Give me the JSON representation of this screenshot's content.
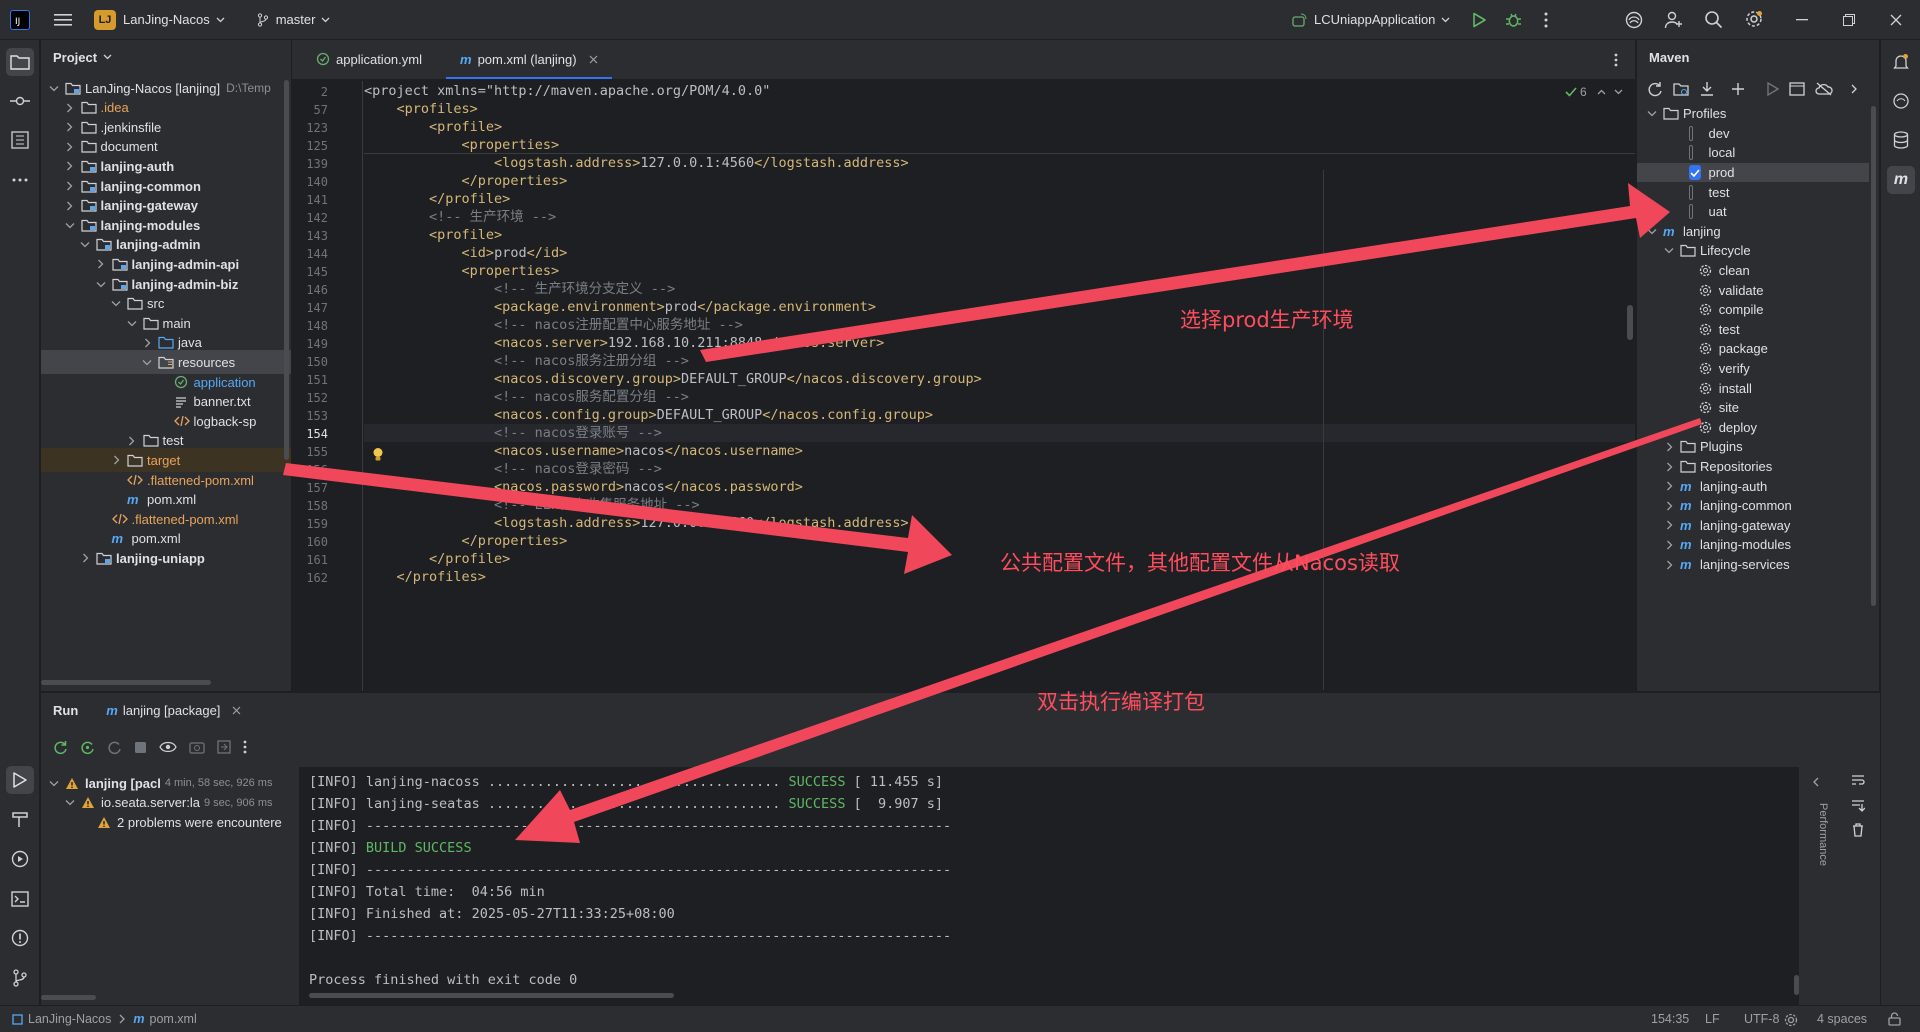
{
  "titlebar": {
    "project_badge": "LJ",
    "project_name": "LanJing-Nacos",
    "branch": "master",
    "run_config": "LCUniappApplication"
  },
  "project_panel": {
    "title": "Project",
    "items": [
      {
        "label": "LanJing-Nacos [lanjing]",
        "hint": "D:\\Temp",
        "depth": 0,
        "expanded": true,
        "kind": "module",
        "bold": false
      },
      {
        "label": ".idea",
        "depth": 1,
        "expanded": false,
        "kind": "folder",
        "color": "orange"
      },
      {
        "label": ".jenkinsfile",
        "depth": 1,
        "expanded": false,
        "kind": "folder"
      },
      {
        "label": "document",
        "depth": 1,
        "expanded": false,
        "kind": "folder"
      },
      {
        "label": "lanjing-auth",
        "depth": 1,
        "expanded": false,
        "kind": "module",
        "bold": true
      },
      {
        "label": "lanjing-common",
        "depth": 1,
        "expanded": false,
        "kind": "module",
        "bold": true
      },
      {
        "label": "lanjing-gateway",
        "depth": 1,
        "expanded": false,
        "kind": "module",
        "bold": true
      },
      {
        "label": "lanjing-modules",
        "depth": 1,
        "expanded": true,
        "kind": "module",
        "bold": true
      },
      {
        "label": "lanjing-admin",
        "depth": 2,
        "expanded": true,
        "kind": "module",
        "bold": true
      },
      {
        "label": "lanjing-admin-api",
        "depth": 3,
        "expanded": false,
        "kind": "module",
        "bold": true
      },
      {
        "label": "lanjing-admin-biz",
        "depth": 3,
        "expanded": true,
        "kind": "module",
        "bold": true
      },
      {
        "label": "src",
        "depth": 4,
        "expanded": true,
        "kind": "folder"
      },
      {
        "label": "main",
        "depth": 5,
        "expanded": true,
        "kind": "folder"
      },
      {
        "label": "java",
        "depth": 6,
        "expanded": false,
        "kind": "folder-blue"
      },
      {
        "label": "resources",
        "depth": 6,
        "expanded": true,
        "kind": "folder-res",
        "selected": true
      },
      {
        "label": "application",
        "depth": 7,
        "kind": "yml",
        "color": "blue"
      },
      {
        "label": "banner.txt",
        "depth": 7,
        "kind": "txt"
      },
      {
        "label": "logback-sp",
        "depth": 7,
        "kind": "xml"
      },
      {
        "label": "test",
        "depth": 5,
        "expanded": false,
        "kind": "folder"
      },
      {
        "label": "target",
        "depth": 4,
        "expanded": false,
        "kind": "folder",
        "color": "orange",
        "highlight": true
      },
      {
        "label": ".flattened-pom.xml",
        "depth": 4,
        "kind": "xml",
        "color": "orange"
      },
      {
        "label": "pom.xml",
        "depth": 4,
        "kind": "maven"
      },
      {
        "label": ".flattened-pom.xml",
        "depth": 3,
        "kind": "xml",
        "color": "orange"
      },
      {
        "label": "pom.xml",
        "depth": 3,
        "kind": "maven"
      },
      {
        "label": "lanjing-uniapp",
        "depth": 2,
        "expanded": false,
        "kind": "module",
        "bold": true
      }
    ]
  },
  "editor": {
    "tabs": [
      {
        "label": "application.yml",
        "active": false
      },
      {
        "label": "pom.xml (lanjing)",
        "active": true
      }
    ],
    "inspections": "6",
    "lines": [
      {
        "n": "2",
        "code": "<project xmlns=\"http://maven.apache.org/POM/4.0.0\"",
        "type": "sticky"
      },
      {
        "n": "57",
        "code": "    <profiles>",
        "type": "sticky"
      },
      {
        "n": "123",
        "code": "        <profile>",
        "type": "sticky"
      },
      {
        "n": "125",
        "code": "            <properties>",
        "type": "sticky"
      },
      {
        "n": "139",
        "code": "                <logstash.address>127.0.0.1:4560</logstash.address>",
        "type": "tag"
      },
      {
        "n": "140",
        "code": "            </properties>",
        "type": "tag"
      },
      {
        "n": "141",
        "code": "        </profile>",
        "type": "tag"
      },
      {
        "n": "142",
        "code": "        <!-- 生产环境 -->",
        "type": "comment"
      },
      {
        "n": "143",
        "code": "        <profile>",
        "type": "tag"
      },
      {
        "n": "144",
        "code": "            <id>prod</id>",
        "type": "tag"
      },
      {
        "n": "145",
        "code": "            <properties>",
        "type": "tag"
      },
      {
        "n": "146",
        "code": "                <!-- 生产环境分支定义 -->",
        "type": "comment"
      },
      {
        "n": "147",
        "code": "                <package.environment>prod</package.environment>",
        "type": "tag"
      },
      {
        "n": "148",
        "code": "                <!-- nacos注册配置中心服务地址 -->",
        "type": "comment"
      },
      {
        "n": "149",
        "code": "                <nacos.server>192.168.10.211:8848</nacos.server>",
        "type": "tag"
      },
      {
        "n": "150",
        "code": "                <!-- nacos服务注册分组 -->",
        "type": "comment"
      },
      {
        "n": "151",
        "code": "                <nacos.discovery.group>DEFAULT_GROUP</nacos.discovery.group>",
        "type": "tag"
      },
      {
        "n": "152",
        "code": "                <!-- nacos服务配置分组 -->",
        "type": "comment"
      },
      {
        "n": "153",
        "code": "                <nacos.config.group>DEFAULT_GROUP</nacos.config.group>",
        "type": "tag"
      },
      {
        "n": "154",
        "code": "                <!-- nacos登录账号 -->",
        "type": "comment",
        "current": true
      },
      {
        "n": "155",
        "code": "                <nacos.username>nacos</nacos.username>",
        "type": "tag"
      },
      {
        "n": "156",
        "code": "                <!-- nacos登录密码 -->",
        "type": "comment"
      },
      {
        "n": "157",
        "code": "                <nacos.password>nacos</nacos.password>",
        "type": "tag"
      },
      {
        "n": "158",
        "code": "                <!-- ELK日志收集服务地址 -->",
        "type": "comment"
      },
      {
        "n": "159",
        "code": "                <logstash.address>127.0.0.1:4560</logstash.address>",
        "type": "tag"
      },
      {
        "n": "160",
        "code": "            </properties>",
        "type": "tag"
      },
      {
        "n": "161",
        "code": "        </profile>",
        "type": "tag"
      },
      {
        "n": "162",
        "code": "    </profiles>",
        "type": "tag"
      }
    ]
  },
  "maven": {
    "title": "Maven",
    "profiles_label": "Profiles",
    "profiles": [
      {
        "name": "dev",
        "checked": false
      },
      {
        "name": "local",
        "checked": false
      },
      {
        "name": "prod",
        "checked": true
      },
      {
        "name": "test",
        "checked": false
      },
      {
        "name": "uat",
        "checked": false
      }
    ],
    "root": "lanjing",
    "lifecycle_label": "Lifecycle",
    "lifecycle": [
      "clean",
      "validate",
      "compile",
      "test",
      "package",
      "verify",
      "install",
      "site",
      "deploy"
    ],
    "plugins_label": "Plugins",
    "repositories_label": "Repositories",
    "modules": [
      "lanjing-auth",
      "lanjing-common",
      "lanjing-gateway",
      "lanjing-modules",
      "lanjing-services"
    ]
  },
  "run": {
    "title": "Run",
    "tab": "lanjing [package]",
    "tree": [
      {
        "label": "lanjing [pacl",
        "time": "4 min, 58 sec, 926 ms",
        "warn": true,
        "bold": true
      },
      {
        "label": "io.seata.server:la",
        "time": "9 sec, 906 ms",
        "warn": true
      },
      {
        "label": "2 problems were encountere",
        "time": "",
        "warn": true
      }
    ],
    "console": [
      {
        "pre": "[INFO] ",
        "text": "lanjing-nacoss .................................... ",
        "ok": "SUCCESS",
        "post": " [ 11.455 s]"
      },
      {
        "pre": "[INFO] ",
        "text": "lanjing-seatas .................................... ",
        "ok": "SUCCESS",
        "post": " [  9.907 s]"
      },
      {
        "pre": "[INFO] ",
        "text": "------------------------------------------------------------------------",
        "ok": "",
        "post": ""
      },
      {
        "pre": "[INFO] ",
        "text": "",
        "ok": "BUILD SUCCESS",
        "post": ""
      },
      {
        "pre": "[INFO] ",
        "text": "------------------------------------------------------------------------",
        "ok": "",
        "post": ""
      },
      {
        "pre": "[INFO] ",
        "text": "Total time:  04:56 min",
        "ok": "",
        "post": ""
      },
      {
        "pre": "[INFO] ",
        "text": "Finished at: 2025-05-27T11:33:25+08:00",
        "ok": "",
        "post": ""
      },
      {
        "pre": "[INFO] ",
        "text": "------------------------------------------------------------------------",
        "ok": "",
        "post": ""
      },
      {
        "pre": "",
        "text": "",
        "ok": "",
        "post": ""
      },
      {
        "pre": "",
        "text": "Process finished with exit code 0",
        "ok": "",
        "post": ""
      }
    ],
    "side_label": "Performance"
  },
  "annotations": {
    "select_prod": "选择prod生产环境",
    "common_config": "公共配置文件，其他配置文件从Nacos读取",
    "double_click": "双击执行编译打包"
  },
  "statusbar": {
    "project": "LanJing-Nacos",
    "file": "pom.xml",
    "position": "154:35",
    "line_sep": "LF",
    "encoding": "UTF-8",
    "indent": "4 spaces"
  },
  "colors": {
    "accent": "#3574f0",
    "annotation": "#ff4d5e",
    "success": "#5fb865"
  }
}
